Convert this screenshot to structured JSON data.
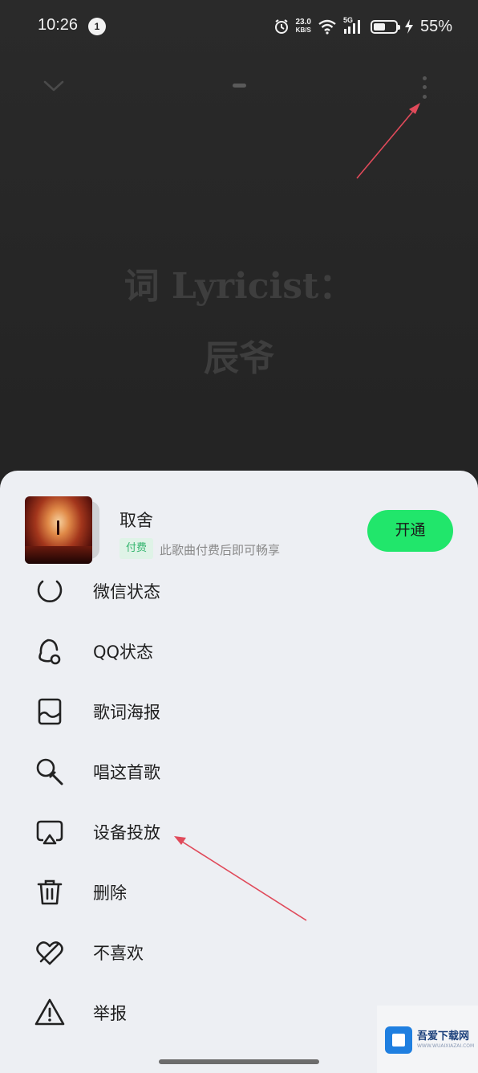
{
  "status_bar": {
    "time": "10:26",
    "notification_count": "1",
    "net_speed_value": "23.0",
    "net_speed_unit": "KB/S",
    "network_type": "5G",
    "battery_percent": "55%",
    "battery_level": 0.55,
    "icons": [
      "alarm-icon",
      "wifi-icon",
      "signal-icon",
      "battery-icon",
      "charging-icon"
    ]
  },
  "player": {
    "collapse_icon": "chevron-down-icon",
    "more_icon": "more-vertical-icon",
    "lyrics": [
      "词 Lyricist：",
      "辰爷"
    ]
  },
  "song": {
    "title": "取舍",
    "tag": "付费",
    "pay_hint": "此歌曲付费后即可畅享",
    "open_button": "开通",
    "accent_color": "#21e66b"
  },
  "menu": [
    {
      "label": "微信状态",
      "icon": "wechat-status-icon"
    },
    {
      "label": "QQ状态",
      "icon": "qq-status-icon"
    },
    {
      "label": "歌词海报",
      "icon": "lyric-poster-icon"
    },
    {
      "label": "唱这首歌",
      "icon": "microphone-icon"
    },
    {
      "label": "设备投放",
      "icon": "cast-device-icon"
    },
    {
      "label": "删除",
      "icon": "trash-icon"
    },
    {
      "label": "不喜欢",
      "icon": "dislike-heart-icon"
    },
    {
      "label": "举报",
      "icon": "warning-icon"
    }
  ],
  "watermark": {
    "name": "吾爱下载网",
    "url": "WWW.WUAIXIAZAI.COM"
  }
}
